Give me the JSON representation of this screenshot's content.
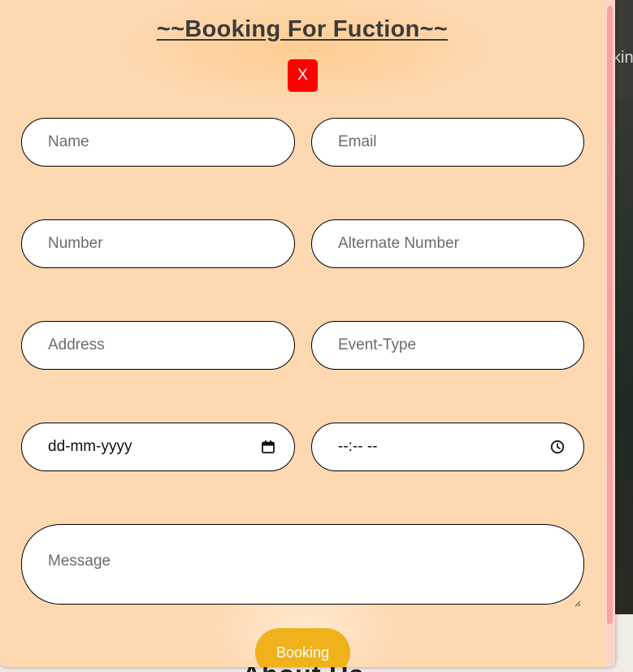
{
  "background": {
    "right_text": "kin",
    "bottom_text": "About Us"
  },
  "modal": {
    "title": "~~Booking For Fuction~~",
    "close_label": "X",
    "fields": {
      "name_placeholder": "Name",
      "email_placeholder": "Email",
      "number_placeholder": "Number",
      "alternate_number_placeholder": "Alternate Number",
      "address_placeholder": "Address",
      "event_type_placeholder": "Event-Type",
      "date_value": "dd-mm-yyyy",
      "time_value": "--:-- --",
      "message_placeholder": "Message"
    },
    "submit_label": "Booking"
  },
  "colors": {
    "modal_bg": "#fed8b1",
    "close_bg": "#ff0000",
    "submit_bg": "#f0b21a",
    "scrollbar_thumb": "#f7a3a3"
  },
  "icons": {
    "date": "calendar-icon",
    "time": "clock-icon"
  }
}
